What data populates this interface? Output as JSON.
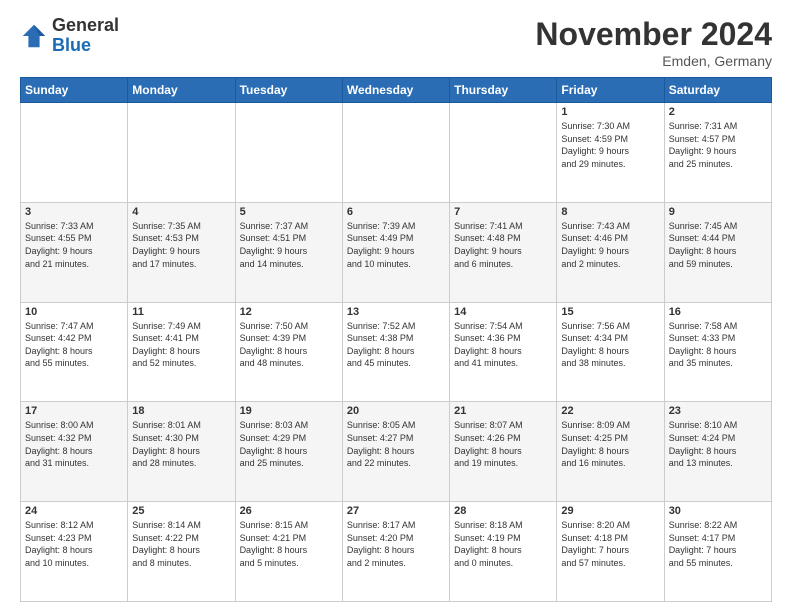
{
  "logo": {
    "general": "General",
    "blue": "Blue"
  },
  "title": "November 2024",
  "subtitle": "Emden, Germany",
  "headers": [
    "Sunday",
    "Monday",
    "Tuesday",
    "Wednesday",
    "Thursday",
    "Friday",
    "Saturday"
  ],
  "weeks": [
    [
      {
        "day": "",
        "info": ""
      },
      {
        "day": "",
        "info": ""
      },
      {
        "day": "",
        "info": ""
      },
      {
        "day": "",
        "info": ""
      },
      {
        "day": "",
        "info": ""
      },
      {
        "day": "1",
        "info": "Sunrise: 7:30 AM\nSunset: 4:59 PM\nDaylight: 9 hours\nand 29 minutes."
      },
      {
        "day": "2",
        "info": "Sunrise: 7:31 AM\nSunset: 4:57 PM\nDaylight: 9 hours\nand 25 minutes."
      }
    ],
    [
      {
        "day": "3",
        "info": "Sunrise: 7:33 AM\nSunset: 4:55 PM\nDaylight: 9 hours\nand 21 minutes."
      },
      {
        "day": "4",
        "info": "Sunrise: 7:35 AM\nSunset: 4:53 PM\nDaylight: 9 hours\nand 17 minutes."
      },
      {
        "day": "5",
        "info": "Sunrise: 7:37 AM\nSunset: 4:51 PM\nDaylight: 9 hours\nand 14 minutes."
      },
      {
        "day": "6",
        "info": "Sunrise: 7:39 AM\nSunset: 4:49 PM\nDaylight: 9 hours\nand 10 minutes."
      },
      {
        "day": "7",
        "info": "Sunrise: 7:41 AM\nSunset: 4:48 PM\nDaylight: 9 hours\nand 6 minutes."
      },
      {
        "day": "8",
        "info": "Sunrise: 7:43 AM\nSunset: 4:46 PM\nDaylight: 9 hours\nand 2 minutes."
      },
      {
        "day": "9",
        "info": "Sunrise: 7:45 AM\nSunset: 4:44 PM\nDaylight: 8 hours\nand 59 minutes."
      }
    ],
    [
      {
        "day": "10",
        "info": "Sunrise: 7:47 AM\nSunset: 4:42 PM\nDaylight: 8 hours\nand 55 minutes."
      },
      {
        "day": "11",
        "info": "Sunrise: 7:49 AM\nSunset: 4:41 PM\nDaylight: 8 hours\nand 52 minutes."
      },
      {
        "day": "12",
        "info": "Sunrise: 7:50 AM\nSunset: 4:39 PM\nDaylight: 8 hours\nand 48 minutes."
      },
      {
        "day": "13",
        "info": "Sunrise: 7:52 AM\nSunset: 4:38 PM\nDaylight: 8 hours\nand 45 minutes."
      },
      {
        "day": "14",
        "info": "Sunrise: 7:54 AM\nSunset: 4:36 PM\nDaylight: 8 hours\nand 41 minutes."
      },
      {
        "day": "15",
        "info": "Sunrise: 7:56 AM\nSunset: 4:34 PM\nDaylight: 8 hours\nand 38 minutes."
      },
      {
        "day": "16",
        "info": "Sunrise: 7:58 AM\nSunset: 4:33 PM\nDaylight: 8 hours\nand 35 minutes."
      }
    ],
    [
      {
        "day": "17",
        "info": "Sunrise: 8:00 AM\nSunset: 4:32 PM\nDaylight: 8 hours\nand 31 minutes."
      },
      {
        "day": "18",
        "info": "Sunrise: 8:01 AM\nSunset: 4:30 PM\nDaylight: 8 hours\nand 28 minutes."
      },
      {
        "day": "19",
        "info": "Sunrise: 8:03 AM\nSunset: 4:29 PM\nDaylight: 8 hours\nand 25 minutes."
      },
      {
        "day": "20",
        "info": "Sunrise: 8:05 AM\nSunset: 4:27 PM\nDaylight: 8 hours\nand 22 minutes."
      },
      {
        "day": "21",
        "info": "Sunrise: 8:07 AM\nSunset: 4:26 PM\nDaylight: 8 hours\nand 19 minutes."
      },
      {
        "day": "22",
        "info": "Sunrise: 8:09 AM\nSunset: 4:25 PM\nDaylight: 8 hours\nand 16 minutes."
      },
      {
        "day": "23",
        "info": "Sunrise: 8:10 AM\nSunset: 4:24 PM\nDaylight: 8 hours\nand 13 minutes."
      }
    ],
    [
      {
        "day": "24",
        "info": "Sunrise: 8:12 AM\nSunset: 4:23 PM\nDaylight: 8 hours\nand 10 minutes."
      },
      {
        "day": "25",
        "info": "Sunrise: 8:14 AM\nSunset: 4:22 PM\nDaylight: 8 hours\nand 8 minutes."
      },
      {
        "day": "26",
        "info": "Sunrise: 8:15 AM\nSunset: 4:21 PM\nDaylight: 8 hours\nand 5 minutes."
      },
      {
        "day": "27",
        "info": "Sunrise: 8:17 AM\nSunset: 4:20 PM\nDaylight: 8 hours\nand 2 minutes."
      },
      {
        "day": "28",
        "info": "Sunrise: 8:18 AM\nSunset: 4:19 PM\nDaylight: 8 hours\nand 0 minutes."
      },
      {
        "day": "29",
        "info": "Sunrise: 8:20 AM\nSunset: 4:18 PM\nDaylight: 7 hours\nand 57 minutes."
      },
      {
        "day": "30",
        "info": "Sunrise: 8:22 AM\nSunset: 4:17 PM\nDaylight: 7 hours\nand 55 minutes."
      }
    ]
  ]
}
